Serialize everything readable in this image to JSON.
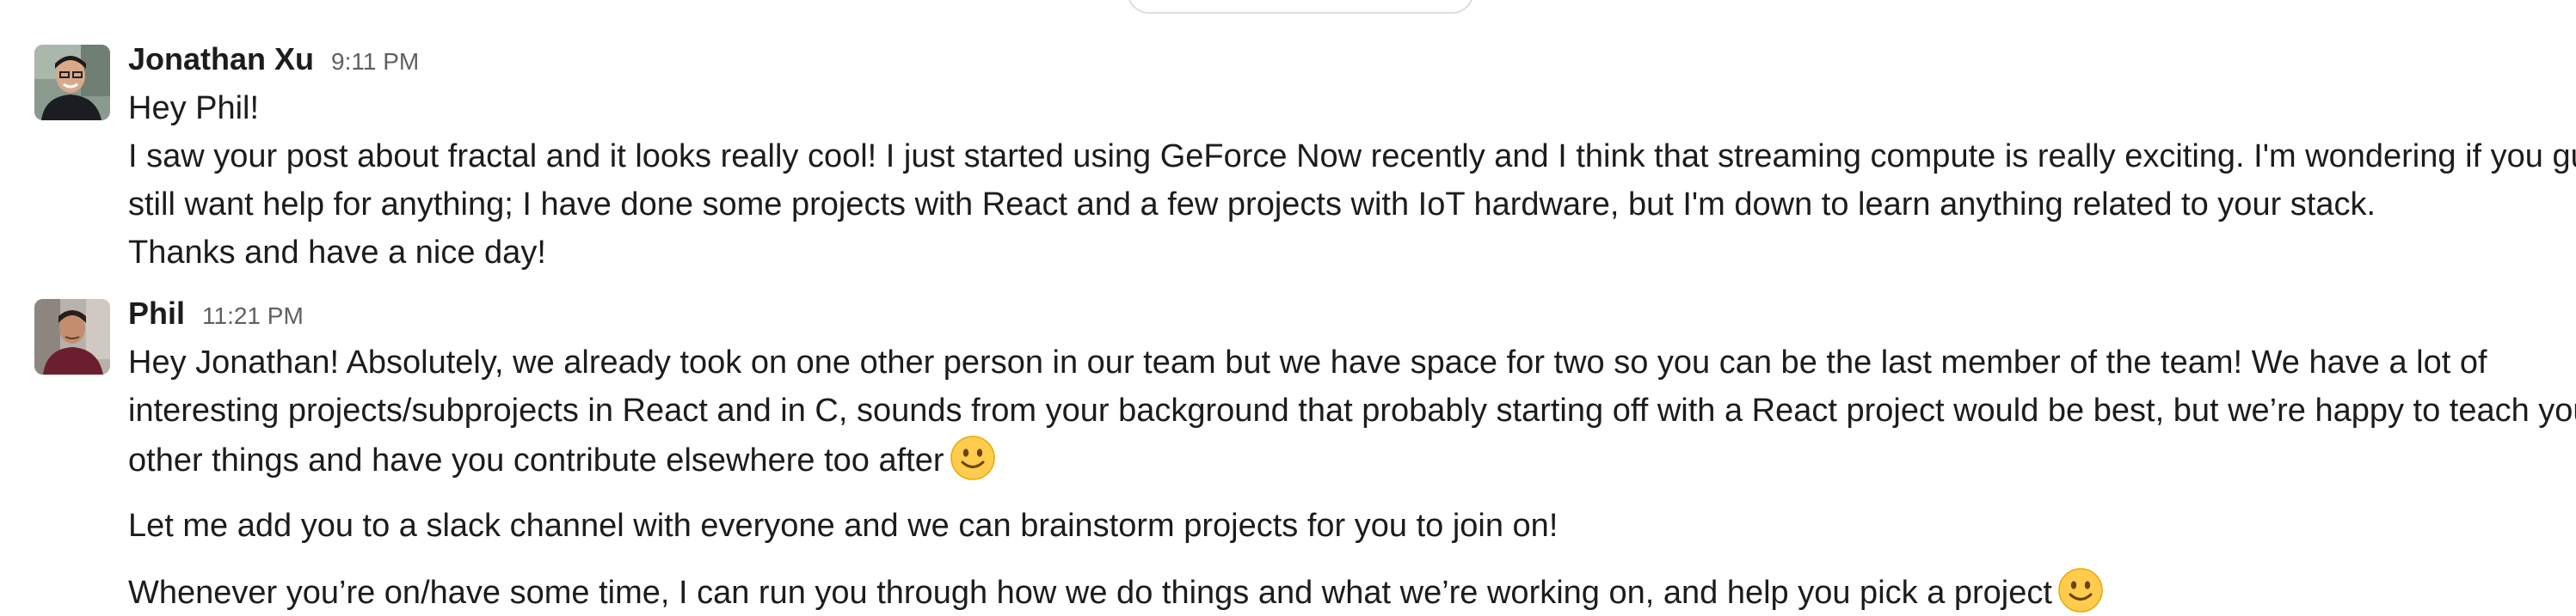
{
  "messages": [
    {
      "sender": "Jonathan Xu",
      "time": "9:11 PM",
      "avatar_icon": "user-avatar-photo",
      "lines": [
        "Hey Phil!",
        "I saw your post about fractal and it looks really cool! I just started using GeForce Now recently and I think that streaming compute is really exciting. I'm wondering if you guys",
        "still want help for anything; I have done some projects with React and a few projects with IoT hardware, but I'm down to learn anything related to your stack.",
        "Thanks and have a nice day!"
      ]
    },
    {
      "sender": "Phil",
      "time": "11:21 PM",
      "avatar_icon": "user-avatar-photo",
      "lines": [
        "Hey Jonathan! Absolutely, we already took on one other person in our team but we have space for two so you can be the last member of the team! We have a lot of",
        "interesting projects/subprojects in React and in C, sounds from your background that probably starting off with a React project would be best, but we’re happy to teach you",
        "other things and have you contribute elsewhere too after",
        "Let me add you to a slack channel with everyone and we can brainstorm projects for you to join on!",
        "Whenever you’re on/have some time, I can run you through how we do things and what we’re working on, and help you pick a project"
      ],
      "emoji_icon": "slightly-smiling-face-icon"
    }
  ]
}
